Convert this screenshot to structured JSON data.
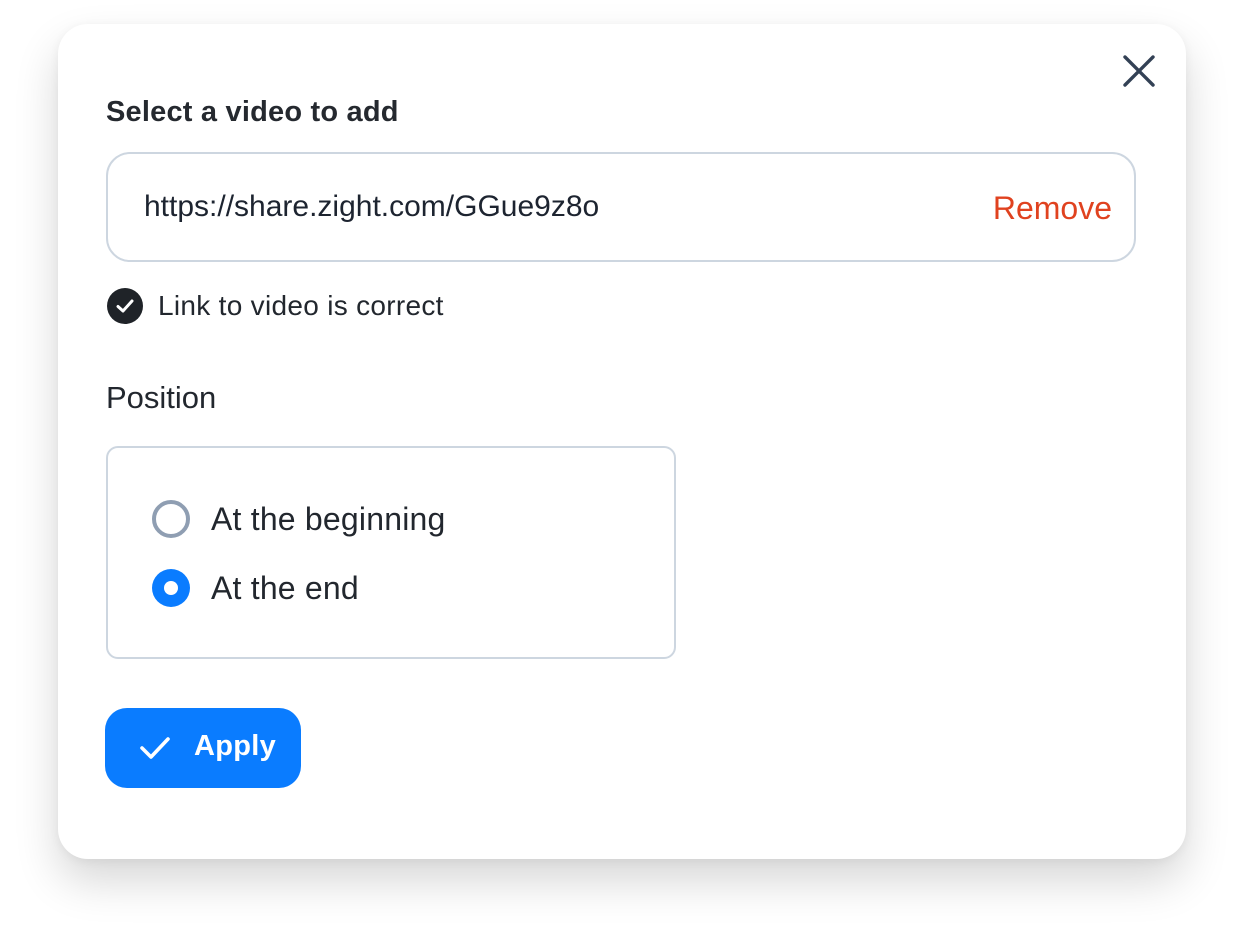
{
  "dialog": {
    "title": "Select a video to add",
    "close_icon": "close-icon"
  },
  "url_field": {
    "value": "https://share.zight.com/GGue9z8o",
    "remove_label": "Remove"
  },
  "validation": {
    "icon": "check-circle-icon",
    "message": "Link to video is correct"
  },
  "position": {
    "label": "Position",
    "options": [
      {
        "label": "At the beginning",
        "selected": false
      },
      {
        "label": "At the end",
        "selected": true
      }
    ]
  },
  "apply_button": {
    "icon": "checkmark-icon",
    "label": "Apply"
  },
  "colors": {
    "accent": "#0a7cff",
    "danger": "#e0421f",
    "border": "#cdd6e0",
    "radio_off": "#8f9eb2"
  }
}
